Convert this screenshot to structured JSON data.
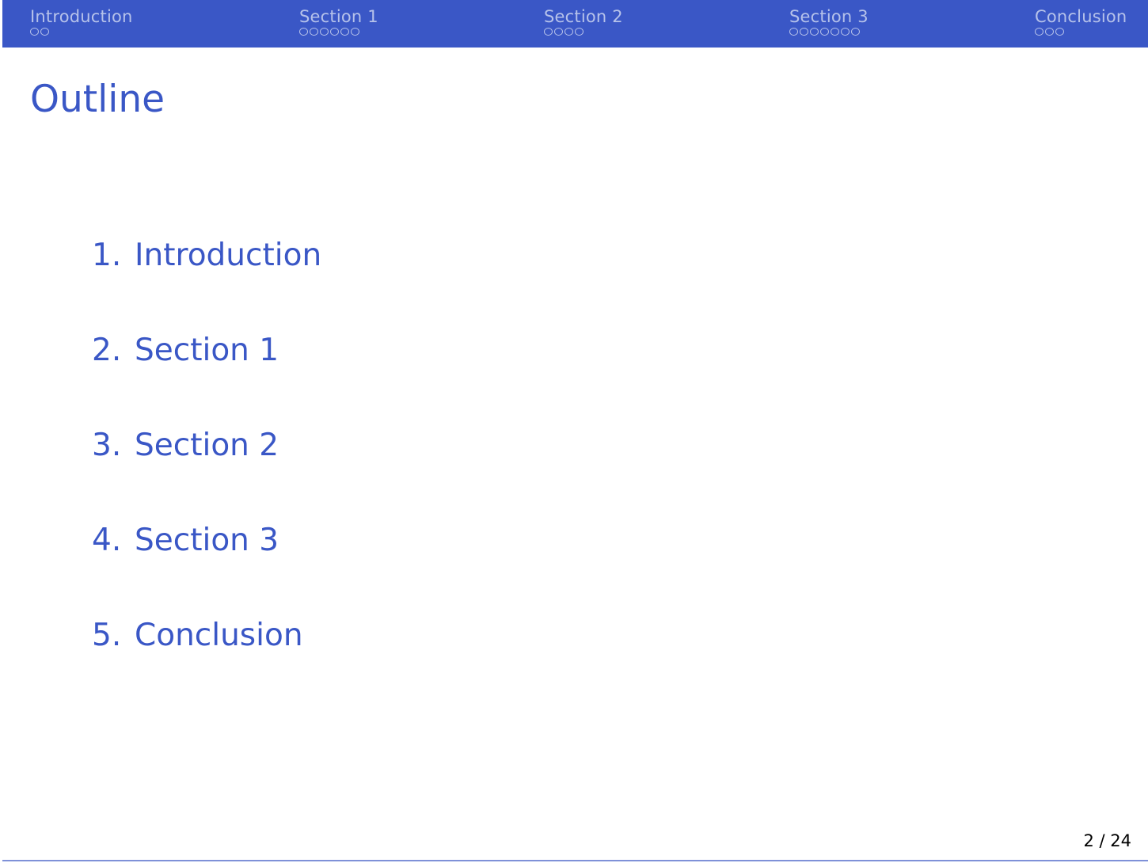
{
  "headline": {
    "sections": [
      {
        "title": "Introduction",
        "dot_count": 2
      },
      {
        "title": "Section 1",
        "dot_count": 6
      },
      {
        "title": "Section 2",
        "dot_count": 4
      },
      {
        "title": "Section 3",
        "dot_count": 7
      },
      {
        "title": "Conclusion",
        "dot_count": 3
      }
    ]
  },
  "frame": {
    "title": "Outline"
  },
  "toc": {
    "items": [
      {
        "number": "1.",
        "label": "Introduction"
      },
      {
        "number": "2.",
        "label": "Section 1"
      },
      {
        "number": "3.",
        "label": "Section 2"
      },
      {
        "number": "4.",
        "label": "Section 3"
      },
      {
        "number": "5.",
        "label": "Conclusion"
      }
    ]
  },
  "footer": {
    "page_number": "2 / 24"
  },
  "colors": {
    "theme_blue": "#3a57c6",
    "nav_text": "#b6c2ea"
  }
}
